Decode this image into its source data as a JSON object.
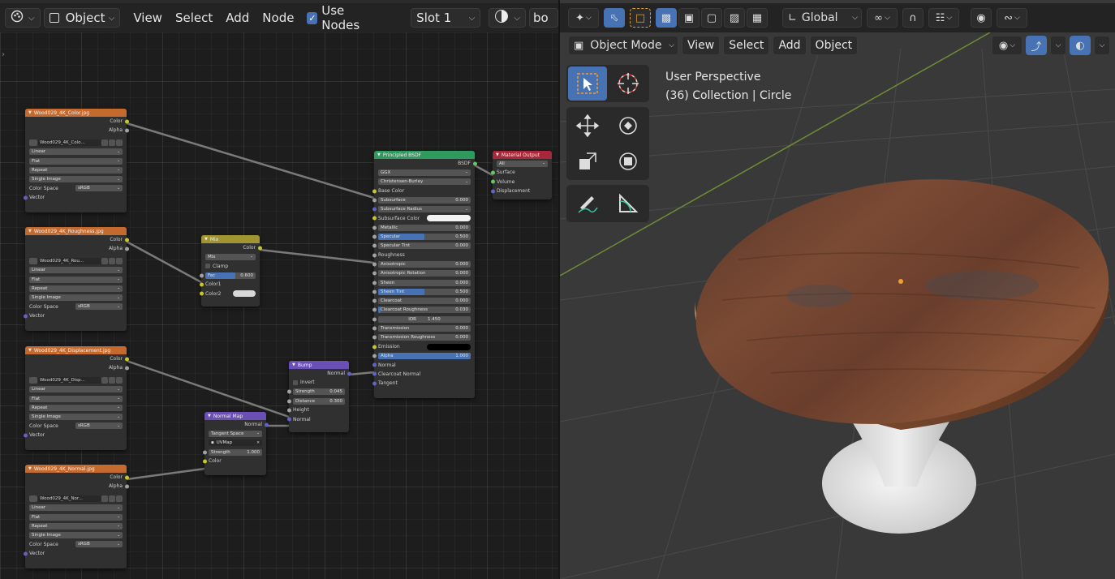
{
  "node_editor": {
    "header": {
      "object_label": "Object",
      "menu": [
        "View",
        "Select",
        "Add",
        "Node"
      ],
      "use_nodes_label": "Use Nodes",
      "slot_label": "Slot 1",
      "truncated_label": "bo"
    },
    "nodes": {
      "color_img": {
        "title": "Wood029_4K_Color.jpg",
        "out_color": "Color",
        "out_alpha": "Alpha",
        "image_name": "Wood029_4K_Colo...",
        "interp": "Linear",
        "proj": "Flat",
        "ext": "Repeat",
        "source": "Single Image",
        "colorspace_label": "Color Space",
        "colorspace_value": "sRGB",
        "in_vector": "Vector"
      },
      "rough_img": {
        "title": "Wood029_4K_Roughness.jpg",
        "out_color": "Color",
        "out_alpha": "Alpha",
        "image_name": "Wood029_4K_Rou...",
        "interp": "Linear",
        "proj": "Flat",
        "ext": "Repeat",
        "source": "Single Image",
        "colorspace_label": "Color Space",
        "colorspace_value": "sRGB",
        "in_vector": "Vector"
      },
      "disp_img": {
        "title": "Wood029_4K_Displacement.jpg",
        "out_color": "Color",
        "out_alpha": "Alpha",
        "image_name": "Wood029_4K_Disp...",
        "interp": "Linear",
        "proj": "Flat",
        "ext": "Repeat",
        "source": "Single Image",
        "colorspace_label": "Color Space",
        "colorspace_value": "sRGB",
        "in_vector": "Vector"
      },
      "normal_img": {
        "title": "Wood029_4K_Normal.jpg",
        "out_color": "Color",
        "out_alpha": "Alpha",
        "image_name": "Wood029_4K_Nor...",
        "interp": "Linear",
        "proj": "Flat",
        "ext": "Repeat",
        "source": "Single Image",
        "colorspace_label": "Color Space",
        "colorspace_value": "sRGB",
        "in_vector": "Vector"
      },
      "mix": {
        "title": "Mix",
        "out_color": "Color",
        "blend": "Mix",
        "clamp": "Clamp",
        "fac_label": "Fac",
        "fac_value": "0.600",
        "fac_fraction": 0.6,
        "color1": "Color1",
        "color2": "Color2"
      },
      "bump": {
        "title": "Bump",
        "out_normal": "Normal",
        "invert": "Invert",
        "strength_label": "Strength",
        "strength_value": "0.045",
        "distance_label": "Distance",
        "distance_value": "0.300",
        "height": "Height",
        "normal": "Normal"
      },
      "normal_map": {
        "title": "Normal Map",
        "out_normal": "Normal",
        "space": "Tangent Space",
        "uvmap": "UVMap",
        "strength_label": "Strength",
        "strength_value": "1.000",
        "color": "Color"
      },
      "principled": {
        "title": "Principled BSDF",
        "out_bsdf": "BSDF",
        "distribution": "GGX",
        "subsurface_method": "Christensen-Burley",
        "base_color": "Base Color",
        "rows": [
          {
            "label": "Subsurface",
            "value": "0.000",
            "fill": 0
          },
          {
            "label": "Subsurface Radius",
            "value": "",
            "fill": 0,
            "dropdown": true
          },
          {
            "label": "Subsurface Color",
            "value": "",
            "swatch": "#f2f2f2"
          },
          {
            "label": "Metallic",
            "value": "0.000",
            "fill": 0
          },
          {
            "label": "Specular",
            "value": "0.500",
            "fill": 0.5
          },
          {
            "label": "Specular Tint",
            "value": "0.000",
            "fill": 0
          },
          {
            "label": "Roughness",
            "value": "",
            "socket_only": true
          },
          {
            "label": "Anisotropic",
            "value": "0.000",
            "fill": 0
          },
          {
            "label": "Anisotropic Rotation",
            "value": "0.000",
            "fill": 0
          },
          {
            "label": "Sheen",
            "value": "0.000",
            "fill": 0
          },
          {
            "label": "Sheen Tint",
            "value": "0.500",
            "fill": 0.5
          },
          {
            "label": "Clearcoat",
            "value": "0.000",
            "fill": 0
          },
          {
            "label": "Clearcoat Roughness",
            "value": "0.030",
            "fill": 0.03
          },
          {
            "label": "IOR",
            "value": "1.450",
            "fill": 0,
            "center": true
          },
          {
            "label": "Transmission",
            "value": "0.000",
            "fill": 0
          },
          {
            "label": "Transmission Roughness",
            "value": "0.000",
            "fill": 0
          },
          {
            "label": "Emission",
            "value": "",
            "swatch": "#000000"
          },
          {
            "label": "Alpha",
            "value": "1.000",
            "fill": 1
          },
          {
            "label": "Normal",
            "value": "",
            "socket_only": true
          },
          {
            "label": "Clearcoat Normal",
            "value": "",
            "socket_only": true
          },
          {
            "label": "Tangent",
            "value": "",
            "socket_only": true
          }
        ]
      },
      "output": {
        "title": "Material Output",
        "target": "All",
        "surface": "Surface",
        "volume": "Volume",
        "displacement": "Displacement"
      }
    }
  },
  "viewport": {
    "header": {
      "orientation": "Global",
      "mode": "Object Mode",
      "menu": [
        "View",
        "Select",
        "Add",
        "Object"
      ]
    },
    "overlay": {
      "view_name": "User Perspective",
      "collection_info": "(36) Collection | Circle"
    },
    "colors": {
      "background": "#393939",
      "accent": "#4772b3",
      "grid_green": "#7b9b3a"
    }
  }
}
